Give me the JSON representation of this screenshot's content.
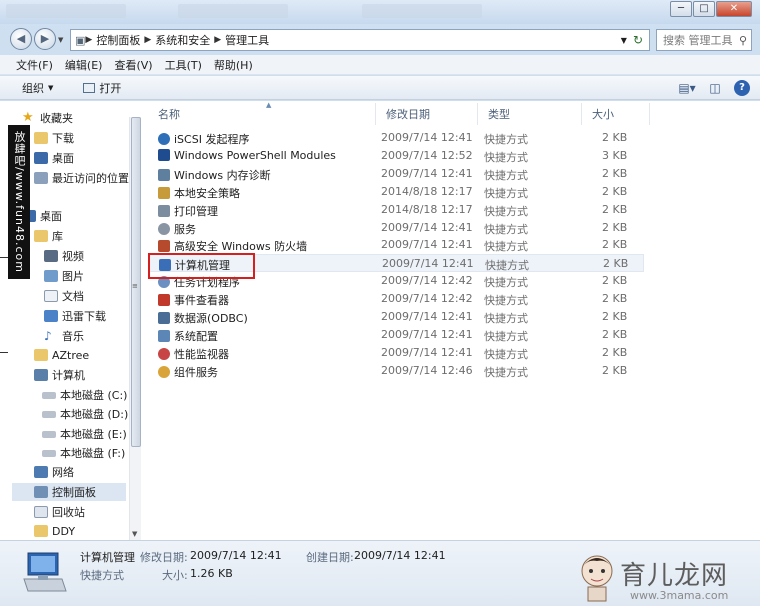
{
  "window": {
    "minimize": "─",
    "maximize": "□",
    "close": "✕"
  },
  "address": {
    "path": [
      "控制面板",
      "系统和安全",
      "管理工具"
    ],
    "search_placeholder": "搜索 管理工具"
  },
  "menu": [
    "文件(F)",
    "编辑(E)",
    "查看(V)",
    "工具(T)",
    "帮助(H)"
  ],
  "toolbar": {
    "organize": "组织",
    "open": "打开"
  },
  "nav": {
    "favorites": {
      "label": "收藏夹",
      "items": [
        "下载",
        "桌面",
        "最近访问的位置"
      ]
    },
    "desktop": "桌面",
    "library": {
      "label": "库",
      "items": [
        "视频",
        "图片",
        "文档",
        "迅雷下载",
        "音乐"
      ]
    },
    "other": [
      "AZtree"
    ],
    "computer": {
      "label": "计算机",
      "items": [
        "本地磁盘 (C:)",
        "本地磁盘 (D:)",
        "本地磁盘 (E:)",
        "本地磁盘 (F:)"
      ]
    },
    "network": "网络",
    "control_panel": "控制面板",
    "recycle": "回收站",
    "ddy": "DDY"
  },
  "watermark": "放肆吧/www.fun48.com",
  "columns": {
    "name": "名称",
    "date": "修改日期",
    "type": "类型",
    "size": "大小"
  },
  "files": [
    {
      "name": "iSCSI 发起程序",
      "date": "2009/7/14 12:41",
      "type": "快捷方式",
      "size": "2 KB",
      "icon": "globe-icon"
    },
    {
      "name": "Windows PowerShell Modules",
      "date": "2009/7/14 12:52",
      "type": "快捷方式",
      "size": "3 KB",
      "icon": "powershell-icon"
    },
    {
      "name": "Windows 内存诊断",
      "date": "2009/7/14 12:41",
      "type": "快捷方式",
      "size": "2 KB",
      "icon": "memory-icon"
    },
    {
      "name": "本地安全策略",
      "date": "2014/8/18 12:17",
      "type": "快捷方式",
      "size": "2 KB",
      "icon": "policy-icon"
    },
    {
      "name": "打印管理",
      "date": "2014/8/18 12:17",
      "type": "快捷方式",
      "size": "2 KB",
      "icon": "printer-icon"
    },
    {
      "name": "服务",
      "date": "2009/7/14 12:41",
      "type": "快捷方式",
      "size": "2 KB",
      "icon": "gear-icon"
    },
    {
      "name": "高级安全 Windows 防火墙",
      "date": "2009/7/14 12:41",
      "type": "快捷方式",
      "size": "2 KB",
      "icon": "firewall-icon"
    },
    {
      "name": "计算机管理",
      "date": "2009/7/14 12:41",
      "type": "快捷方式",
      "size": "2 KB",
      "icon": "computer-manage-icon"
    },
    {
      "name": "任务计划程序",
      "date": "2009/7/14 12:42",
      "type": "快捷方式",
      "size": "2 KB",
      "icon": "clock-icon"
    },
    {
      "name": "事件查看器",
      "date": "2009/7/14 12:42",
      "type": "快捷方式",
      "size": "2 KB",
      "icon": "event-icon"
    },
    {
      "name": "数据源(ODBC)",
      "date": "2009/7/14 12:41",
      "type": "快捷方式",
      "size": "2 KB",
      "icon": "database-icon"
    },
    {
      "name": "系统配置",
      "date": "2009/7/14 12:41",
      "type": "快捷方式",
      "size": "2 KB",
      "icon": "sysconfig-icon"
    },
    {
      "name": "性能监视器",
      "date": "2009/7/14 12:41",
      "type": "快捷方式",
      "size": "2 KB",
      "icon": "monitor-icon"
    },
    {
      "name": "组件服务",
      "date": "2009/7/14 12:46",
      "type": "快捷方式",
      "size": "2 KB",
      "icon": "components-icon"
    }
  ],
  "details": {
    "name": "计算机管理",
    "type": "快捷方式",
    "modified_label": "修改日期:",
    "modified": "2009/7/14 12:41",
    "created_label": "创建日期:",
    "created": "2009/7/14 12:41",
    "size_label": "大小:",
    "size": "1.26 KB"
  },
  "brand": {
    "title": "育儿龙网",
    "url": "www.3mama.com"
  },
  "colors": {
    "highlight_box": "#d62020",
    "nav_selected": "#dce6f2"
  }
}
